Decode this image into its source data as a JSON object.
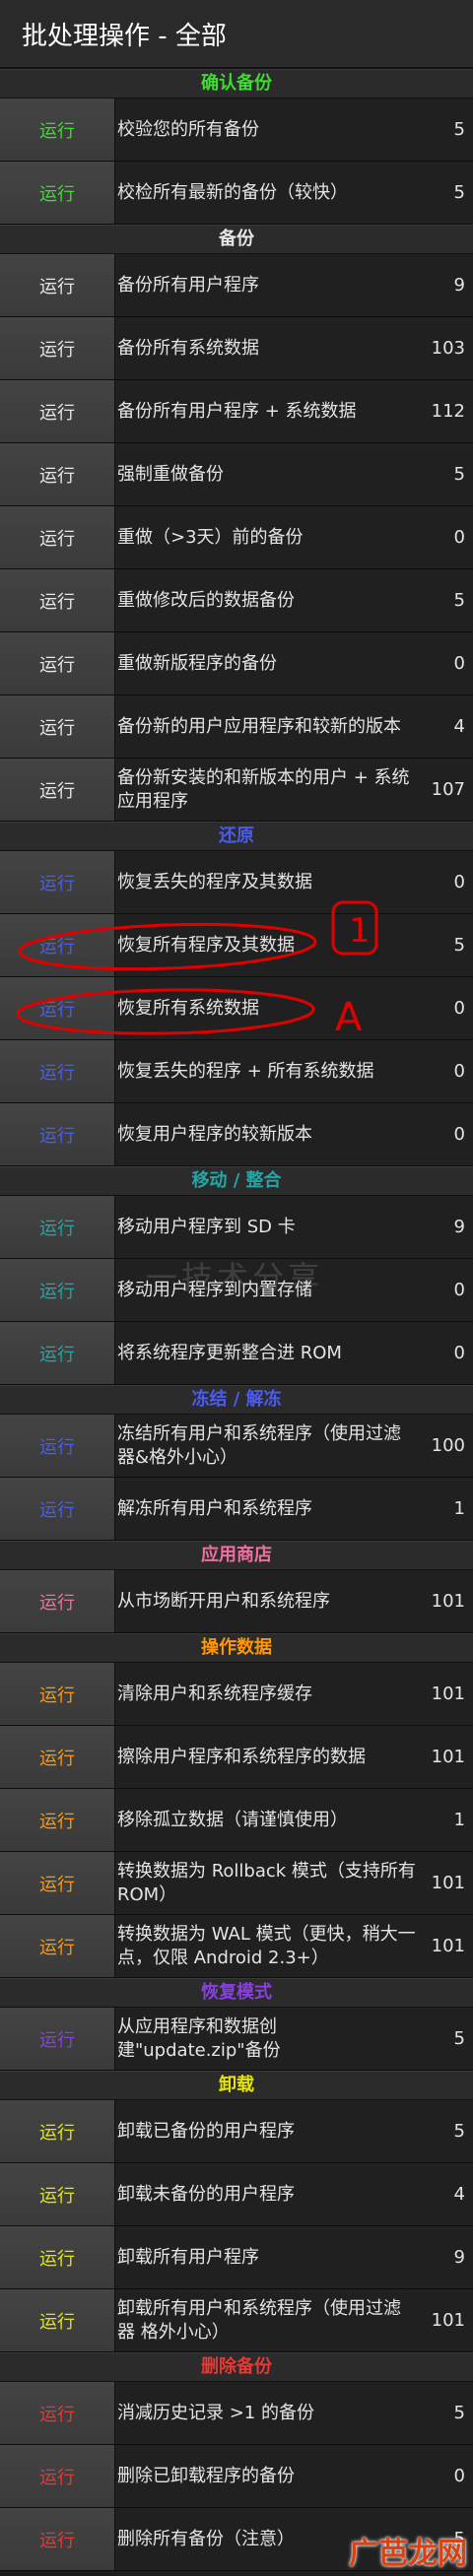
{
  "header": {
    "title": "批处理操作 - 全部"
  },
  "run_label": "运行",
  "colors": {
    "green": "#3ddc2f",
    "white": "#e6e6e6",
    "blue": "#4a5cf0",
    "teal": "#22a6a6",
    "pink": "#ef6fa0",
    "orange": "#ff9800",
    "purple": "#8a3fe0",
    "yellow": "#e6e600",
    "red": "#e53935",
    "section": "#3ddc2f"
  },
  "sections": [
    {
      "title": "确认备份",
      "color": "green",
      "rows": [
        {
          "label": "校验您的所有备份",
          "count": "5"
        },
        {
          "label": "校检所有最新的备份（较快）",
          "count": "5"
        }
      ]
    },
    {
      "title": "备份",
      "color": "white",
      "rows": [
        {
          "label": "备份所有用户程序",
          "count": "9"
        },
        {
          "label": "备份所有系统数据",
          "count": "103"
        },
        {
          "label": "备份所有用户程序 + 系统数据",
          "count": "112"
        },
        {
          "label": "强制重做备份",
          "count": "5"
        },
        {
          "label": "重做（>3天）前的备份",
          "count": "0"
        },
        {
          "label": "重做修改后的数据备份",
          "count": "5"
        },
        {
          "label": "重做新版程序的备份",
          "count": "0"
        },
        {
          "label": "备份新的用户应用程序和较新的版本",
          "count": "4"
        },
        {
          "label": "备份新安装的和新版本的用户 + 系统应用程序",
          "count": "107"
        }
      ]
    },
    {
      "title": "还原",
      "color": "blue",
      "rows": [
        {
          "label": "恢复丢失的程序及其数据",
          "count": "0"
        },
        {
          "label": "恢复所有程序及其数据",
          "count": "5"
        },
        {
          "label": "恢复所有系统数据",
          "count": "0"
        },
        {
          "label": "恢复丢失的程序 + 所有系统数据",
          "count": "0"
        },
        {
          "label": "恢复用户程序的较新版本",
          "count": "0"
        }
      ]
    },
    {
      "title": "移动 / 整合",
      "color": "teal",
      "rows": [
        {
          "label": "移动用户程序到 SD 卡",
          "count": "9"
        },
        {
          "label": "移动用户程序到内置存储",
          "count": "0"
        },
        {
          "label": "将系统程序更新整合进 ROM",
          "count": "0"
        }
      ]
    },
    {
      "title": "冻结 / 解冻",
      "color": "blue",
      "rows": [
        {
          "label": "冻结所有用户和系统程序（使用过滤器&格外小心）",
          "count": "100"
        },
        {
          "label": "解冻所有用户和系统程序",
          "count": "1"
        }
      ]
    },
    {
      "title": "应用商店",
      "color": "pink",
      "rows": [
        {
          "label": "从市场断开用户和系统程序",
          "count": "101"
        }
      ]
    },
    {
      "title": "操作数据",
      "color": "orange",
      "rows": [
        {
          "label": "清除用户和系统程序缓存",
          "count": "101"
        },
        {
          "label": "擦除用户程序和系统程序的数据",
          "count": "101"
        },
        {
          "label": "移除孤立数据（请谨慎使用）",
          "count": "1"
        },
        {
          "label": "转换数据为 Rollback 模式（支持所有ROM）",
          "count": "101"
        },
        {
          "label": "转换数据为 WAL 模式（更快，稍大一点，仅限 Android 2.3+）",
          "count": "101"
        }
      ]
    },
    {
      "title": "恢复模式",
      "color": "purple",
      "rows": [
        {
          "label": "从应用程序和数据创建\"update.zip\"备份",
          "count": "5"
        }
      ]
    },
    {
      "title": "卸载",
      "color": "yellow",
      "rows": [
        {
          "label": "卸载已备份的用户程序",
          "count": "5"
        },
        {
          "label": "卸载未备份的用户程序",
          "count": "4"
        },
        {
          "label": "卸载所有用户程序",
          "count": "9"
        },
        {
          "label": "卸载所有用户和系统程序（使用过滤器 格外小心）",
          "count": "101"
        }
      ]
    },
    {
      "title": "删除备份",
      "color": "red",
      "rows": [
        {
          "label": "消减历史记录 >1 的备份",
          "count": "5"
        },
        {
          "label": "删除已卸载程序的备份",
          "count": "0"
        },
        {
          "label": "删除所有备份（注意）",
          "count": "5"
        }
      ]
    }
  ],
  "annotations": {
    "mark1": "1",
    "mark2": "A"
  },
  "watermark": "一技术分享",
  "logo": "广芭龙网"
}
